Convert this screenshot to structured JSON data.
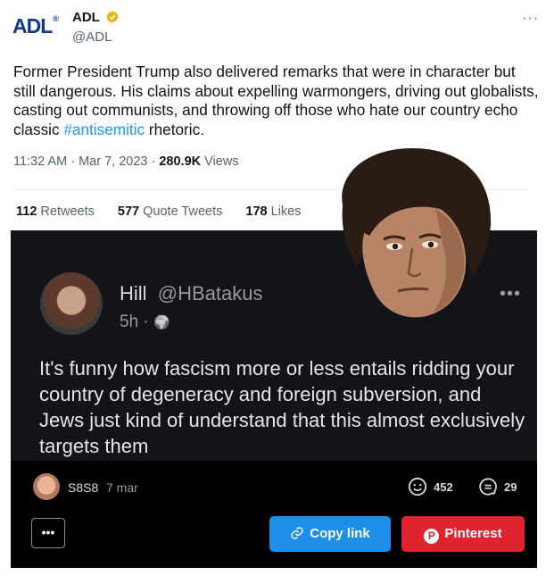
{
  "tweet": {
    "logo_text": "ADL",
    "logo_mark": "®",
    "author_name": "ADL",
    "author_handle": "@ADL",
    "verified_icon": "verified-badge-gold",
    "text_main": "Former President Trump also delivered remarks that were in character but still dangerous. His claims about expelling warmongers, driving out globalists, casting out communists, and throwing off those who hate our country echo classic ",
    "hashtag": "#antisemitic",
    "text_end": " rhetoric.",
    "timestamp": "11:32 AM · Mar 7, 2023 · ",
    "views_count": "280.9K",
    "views_label": " Views",
    "retweets_count": "112",
    "retweets_label": " Retweets",
    "quotes_count": "577",
    "quotes_label": " Quote Tweets",
    "likes_count": "178",
    "likes_label": " Likes",
    "more_icon": "···"
  },
  "embedded_post": {
    "name": "Hill",
    "handle": "@HBatakus",
    "time": "5h · ",
    "globe_icon": "🌍",
    "text": "It's funny how fascism more or less entails ridding your country of degeneracy and foreign subversion, and Jews just kind of understand that this almost exclusively targets them",
    "more_icon": "•••"
  },
  "footer": {
    "commenter_name": "S8S8",
    "comment_time": "7 mar",
    "reaction1_count": "452",
    "reaction2_count": "29",
    "more_button": "•••",
    "copy_link_label": "Copy link",
    "pinterest_label": "Pinterest",
    "pinterest_icon": "P"
  },
  "colors": {
    "link": "#1d9bf0",
    "copy_button": "#1d8fe8",
    "pinterest_button": "#e0242f",
    "logo": "#0d3a8c"
  }
}
